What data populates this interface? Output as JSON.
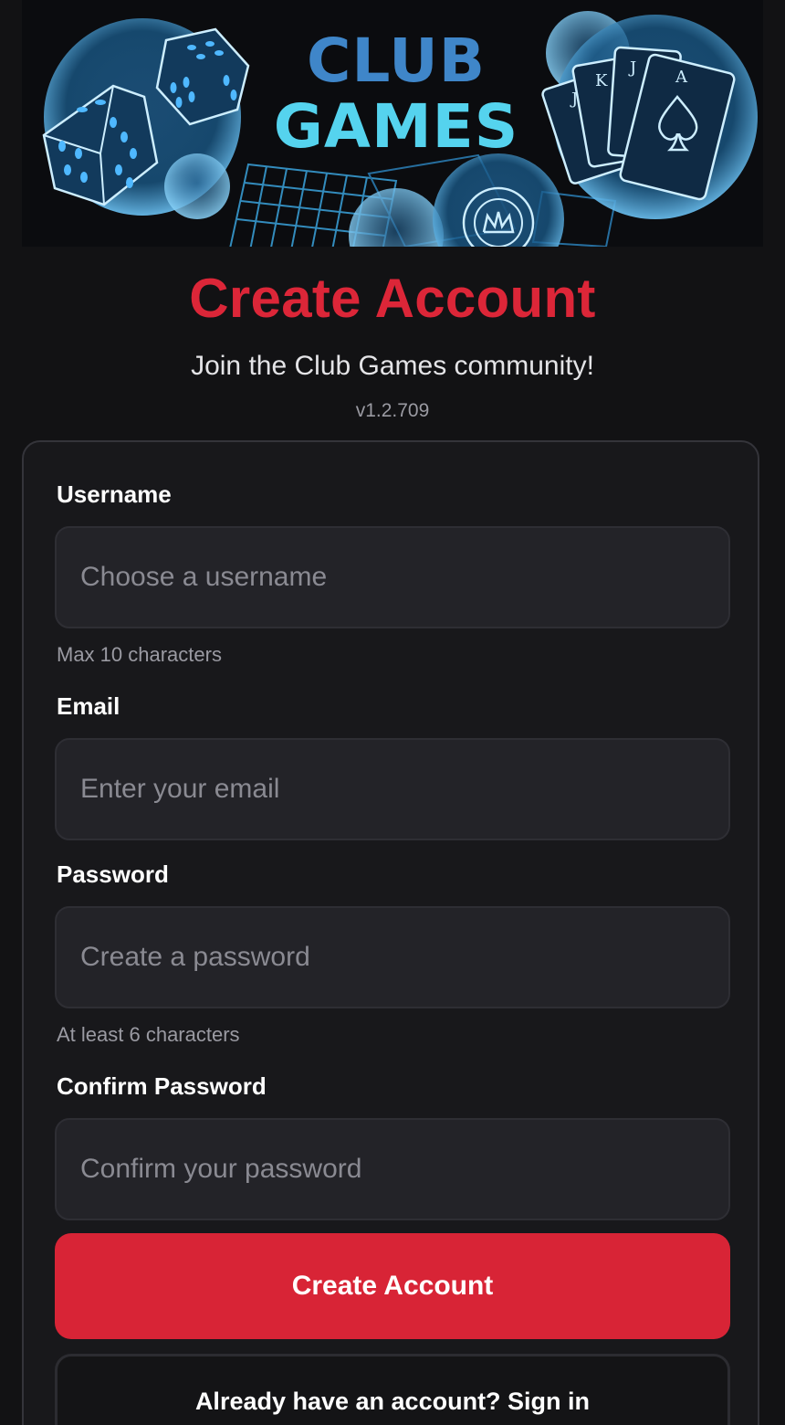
{
  "banner": {
    "logo_line1": "CLUB",
    "logo_line2": "GAMES",
    "artwork_icons": [
      "dice-icon",
      "playing-cards-icon",
      "poker-chip-icon",
      "game-board-icon"
    ]
  },
  "header": {
    "title": "Create Account",
    "subtitle": "Join the Club Games community!",
    "version": "v1.2.709"
  },
  "form": {
    "username": {
      "label": "Username",
      "value": "",
      "placeholder": "Choose a username",
      "hint": "Max 10 characters"
    },
    "email": {
      "label": "Email",
      "value": "",
      "placeholder": "Enter your email"
    },
    "password": {
      "label": "Password",
      "value": "",
      "placeholder": "Create a password",
      "hint": "At least 6 characters"
    },
    "confirm_password": {
      "label": "Confirm Password",
      "value": "",
      "placeholder": "Confirm your password"
    },
    "submit_label": "Create Account",
    "signin_label": "Already have an account? Sign in"
  },
  "colors": {
    "background": "#121214",
    "accent": "#dc2638",
    "card": "#18181b",
    "input": "#232328",
    "logo_blue": "#3f86c9",
    "logo_cyan": "#55d3ee"
  }
}
